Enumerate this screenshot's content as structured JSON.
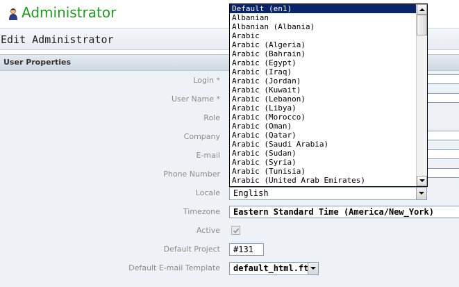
{
  "header": {
    "title": "Administrator",
    "icon": "user-icon"
  },
  "edit_header": {
    "title": "Edit Administrator"
  },
  "section": {
    "title": "User Properties"
  },
  "form": {
    "login_label": "Login *",
    "username_label": "User Name *",
    "role_label": "Role",
    "company_label": "Company",
    "email_label": "E-mail",
    "phone_label": "Phone Number",
    "locale_label": "Locale",
    "locale_value": "English",
    "timezone_label": "Timezone",
    "timezone_value": "Eastern Standard Time (America/New_York)",
    "active_label": "Active",
    "active_checked": true,
    "default_project_label": "Default Project",
    "default_project_value": "#131",
    "default_template_label": "Default E-mail Template",
    "default_template_value": "default_html.ftl"
  },
  "locale_dropdown": {
    "selected": "Default (en1)",
    "items": [
      "Default (en1)",
      "Albanian",
      "Albanian (Albania)",
      "Arabic",
      "Arabic (Algeria)",
      "Arabic (Bahrain)",
      "Arabic (Egypt)",
      "Arabic (Iraq)",
      "Arabic (Jordan)",
      "Arabic (Kuwait)",
      "Arabic (Lebanon)",
      "Arabic (Libya)",
      "Arabic (Morocco)",
      "Arabic (Oman)",
      "Arabic (Qatar)",
      "Arabic (Saudi Arabia)",
      "Arabic (Sudan)",
      "Arabic (Syria)",
      "Arabic (Tunisia)",
      "Arabic (United Arab Emirates)"
    ]
  },
  "colors": {
    "title_green": "#1f9a1f",
    "selection_blue": "#0a246a",
    "label_gray": "#8a8a8a",
    "form_background": "#eef2f6"
  }
}
